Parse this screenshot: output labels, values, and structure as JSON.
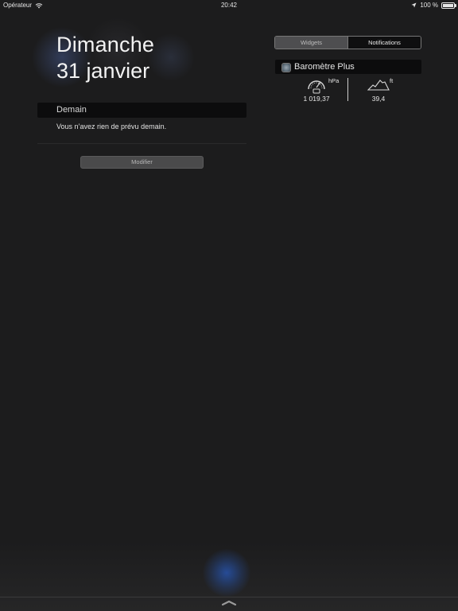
{
  "status_bar": {
    "carrier": "Opérateur",
    "time": "20:42",
    "battery_text": "100 %",
    "battery_level": 1.0
  },
  "date": {
    "day_name": "Dimanche",
    "full_date": "31 janvier"
  },
  "today": {
    "section_title": "Demain",
    "empty_message": "Vous n’avez rien de prévu demain.",
    "edit_button": "Modifier"
  },
  "tabs": [
    {
      "label": "Widgets",
      "selected": true
    },
    {
      "label": "Notifications",
      "selected": false
    }
  ],
  "widget": {
    "title": "Baromètre Plus",
    "icon": "barometer-app-icon",
    "pressure": {
      "unit": "hPa",
      "value": "1 019,37",
      "icon": "gauge-icon"
    },
    "altitude": {
      "unit": "ft",
      "value": "39,4",
      "icon": "mountain-icon"
    }
  },
  "icons": {
    "wifi": "wifi-icon",
    "location": "location-arrow-icon",
    "battery": "battery-icon",
    "handle": "chevron-up-handle-icon"
  }
}
